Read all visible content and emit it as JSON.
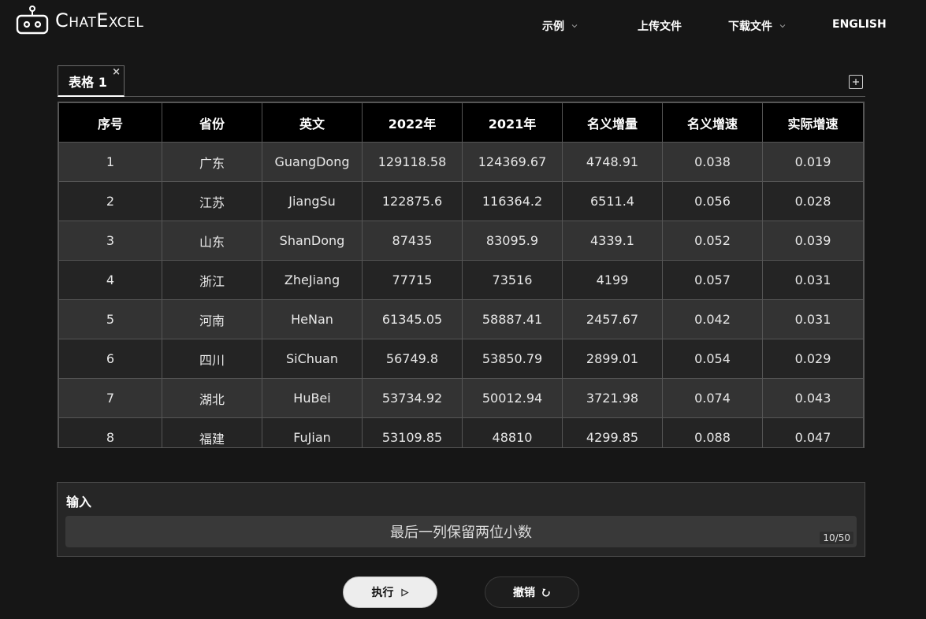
{
  "app": {
    "title": "ChatExcel"
  },
  "nav": {
    "examples": "示例",
    "upload": "上传文件",
    "download": "下载文件",
    "language": "ENGLISH"
  },
  "tabs": [
    {
      "label": "表格 1",
      "close": "×"
    }
  ],
  "add_tab_icon": "plus-icon",
  "table": {
    "headers": [
      "序号",
      "省份",
      "英文",
      "2022年",
      "2021年",
      "名义增量",
      "名义增速",
      "实际增速"
    ],
    "rows": [
      [
        "1",
        "广东",
        "GuangDong",
        "129118.58",
        "124369.67",
        "4748.91",
        "0.038",
        "0.019"
      ],
      [
        "2",
        "江苏",
        "JiangSu",
        "122875.6",
        "116364.2",
        "6511.4",
        "0.056",
        "0.028"
      ],
      [
        "3",
        "山东",
        "ShanDong",
        "87435",
        "83095.9",
        "4339.1",
        "0.052",
        "0.039"
      ],
      [
        "4",
        "浙江",
        "ZheJiang",
        "77715",
        "73516",
        "4199",
        "0.057",
        "0.031"
      ],
      [
        "5",
        "河南",
        "HeNan",
        "61345.05",
        "58887.41",
        "2457.67",
        "0.042",
        "0.031"
      ],
      [
        "6",
        "四川",
        "SiChuan",
        "56749.8",
        "53850.79",
        "2899.01",
        "0.054",
        "0.029"
      ],
      [
        "7",
        "湖北",
        "HuBei",
        "53734.92",
        "50012.94",
        "3721.98",
        "0.074",
        "0.043"
      ],
      [
        "8",
        "福建",
        "FuJian",
        "53109.85",
        "48810",
        "4299.85",
        "0.088",
        "0.047"
      ]
    ]
  },
  "input": {
    "label": "输入",
    "value": "最后一列保留两位小数",
    "counter": "10/50"
  },
  "buttons": {
    "run": "执行",
    "undo": "撤销"
  },
  "colors": {
    "background": "#161616",
    "header_row": "#000000",
    "row_odd": "#333333",
    "row_even": "#242424"
  }
}
